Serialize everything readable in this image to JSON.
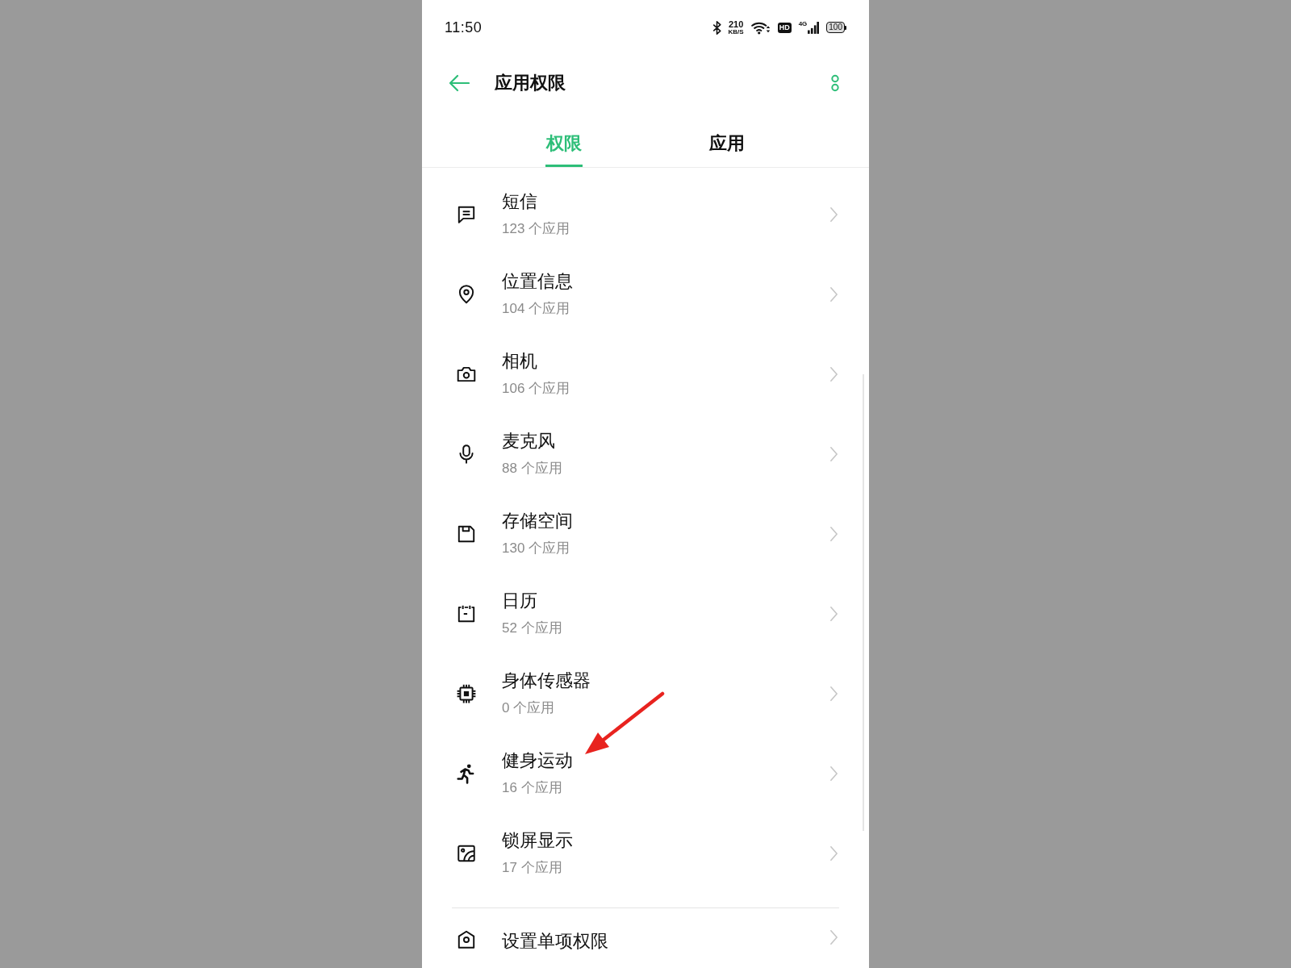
{
  "status_bar": {
    "time": "11:50",
    "net_speed": "210",
    "net_speed_unit": "KB/S",
    "hd": "HD",
    "network": "4G",
    "battery": "100"
  },
  "header": {
    "title": "应用权限"
  },
  "tabs": [
    {
      "label": "权限",
      "selected": true
    },
    {
      "label": "应用",
      "selected": false
    }
  ],
  "permissions": [
    {
      "kind": "sms",
      "title": "短信",
      "subtitle": "123 个应用",
      "annotated": false
    },
    {
      "kind": "location",
      "title": "位置信息",
      "subtitle": "104 个应用",
      "annotated": false
    },
    {
      "kind": "camera",
      "title": "相机",
      "subtitle": "106 个应用",
      "annotated": false
    },
    {
      "kind": "microphone",
      "title": "麦克风",
      "subtitle": "88 个应用",
      "annotated": false
    },
    {
      "kind": "storage",
      "title": "存储空间",
      "subtitle": "130 个应用",
      "annotated": false
    },
    {
      "kind": "calendar",
      "title": "日历",
      "subtitle": "52 个应用",
      "annotated": false
    },
    {
      "kind": "sensors",
      "title": "身体传感器",
      "subtitle": "0 个应用",
      "annotated": false
    },
    {
      "kind": "fitness",
      "title": "健身运动",
      "subtitle": "16 个应用",
      "annotated": true
    },
    {
      "kind": "lockscreen",
      "title": "锁屏显示",
      "subtitle": "17 个应用",
      "annotated": false
    }
  ],
  "more_items": [
    {
      "kind": "custom",
      "title": "设置单项权限"
    }
  ]
}
